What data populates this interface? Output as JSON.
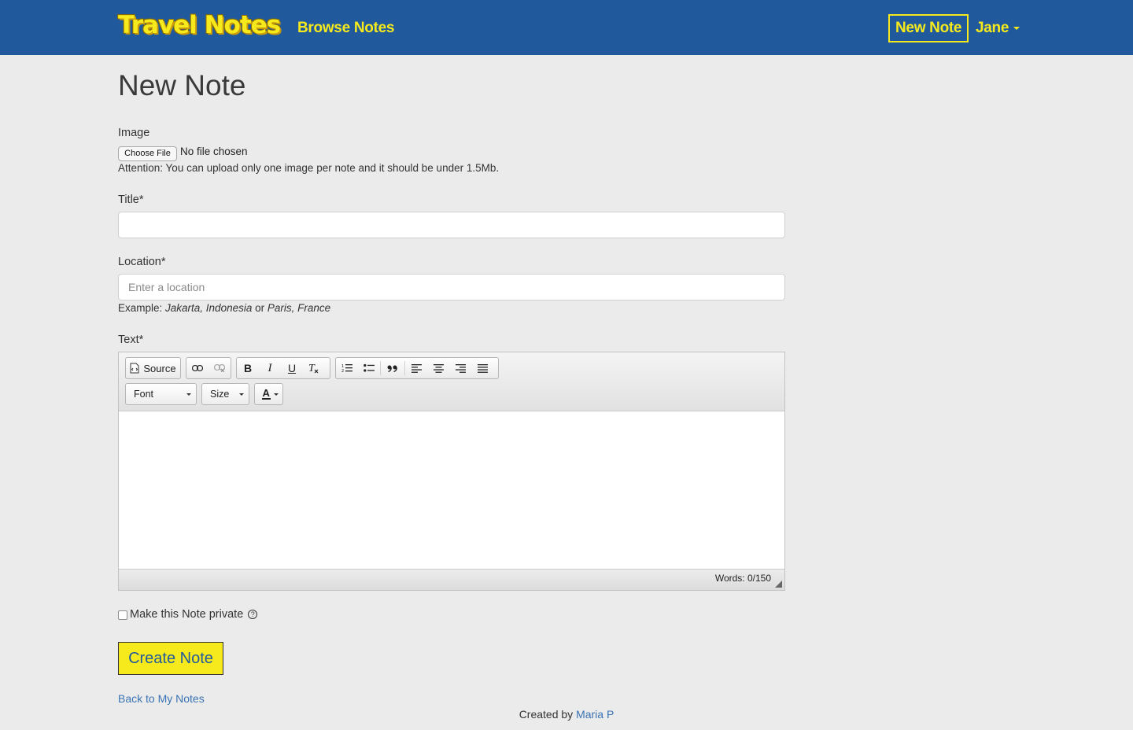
{
  "navbar": {
    "brand": "Travel Notes",
    "browse_label": "Browse Notes",
    "new_note_label": "New Note",
    "user_label": "Jane"
  },
  "page": {
    "title": "New Note"
  },
  "form": {
    "image_label": "Image",
    "file_button": "Choose File",
    "file_status": "No file chosen",
    "image_help": "Attention: You can upload only one image per note and it should be under 1.5Mb.",
    "title_label": "Title*",
    "title_value": "",
    "location_label": "Location*",
    "location_placeholder": "Enter a location",
    "location_help_prefix": "Example: ",
    "location_example_1": "Jakarta, Indonesia",
    "location_help_or": " or ",
    "location_example_2": "Paris, France",
    "text_label": "Text*",
    "private_label": "Make this Note private",
    "private_checked": false,
    "help_glyph": "?",
    "submit_label": "Create Note",
    "back_link": "Back to My Notes"
  },
  "editor": {
    "source_label": "Source",
    "font_label": "Font",
    "size_label": "Size",
    "word_count": "Words: 0/150",
    "toolbar_icons": [
      "source-icon",
      "link-icon",
      "unlink-icon",
      "bold-icon",
      "italic-icon",
      "underline-icon",
      "remove-format-icon",
      "numbered-list-icon",
      "bulleted-list-icon",
      "blockquote-icon",
      "align-left-icon",
      "align-center-icon",
      "align-right-icon",
      "align-justify-icon",
      "text-color-icon"
    ]
  },
  "footer": {
    "created_by": "Created by ",
    "author": "Maria P"
  },
  "colors": {
    "navbar_bg": "#215a9c",
    "accent_yellow": "#f7ea1c",
    "page_bg": "#ebebeb",
    "link_blue": "#3a73b5"
  }
}
